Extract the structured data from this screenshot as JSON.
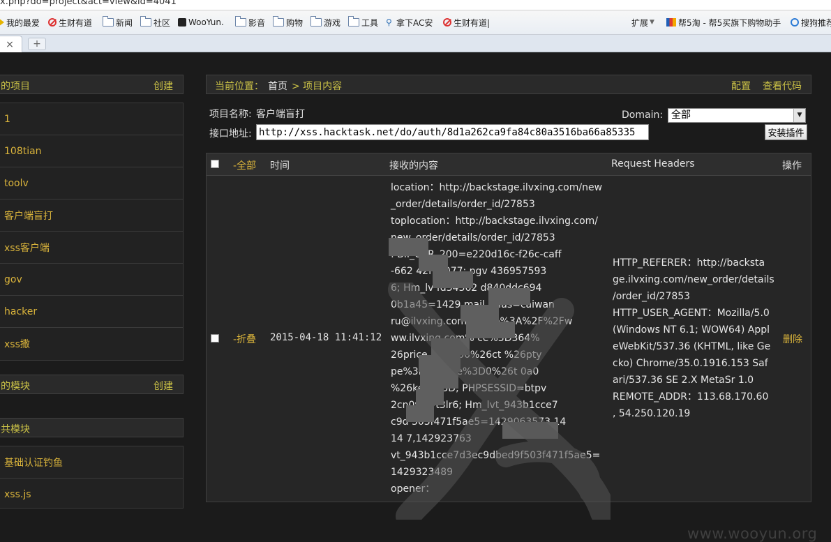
{
  "browser": {
    "url": "x.php?do=project&act=view&id=4041",
    "bookmarks": [
      {
        "label": "我的最爱",
        "icon": "favorites-icon"
      },
      {
        "label": "生财有道",
        "icon": "no-sign-icon"
      },
      {
        "label": "新闻",
        "icon": "folder-icon"
      },
      {
        "label": "社区",
        "icon": "folder-icon"
      },
      {
        "label": "WooYun.",
        "icon": "wooyun-icon"
      },
      {
        "label": "影音",
        "icon": "folder-icon"
      },
      {
        "label": "购物",
        "icon": "folder-icon"
      },
      {
        "label": "游戏",
        "icon": "folder-icon"
      },
      {
        "label": "工具",
        "icon": "folder-icon"
      },
      {
        "label": "拿下AC安",
        "icon": "ac-icon"
      },
      {
        "label": "生财有道|",
        "icon": "no-sign-icon"
      }
    ],
    "extensions_label": "扩展",
    "helper_label": "帮5淘 - 帮5买旗下购物助手",
    "search_label": "搜狗推荐",
    "tab_close": "×",
    "tab_new": "+"
  },
  "sidebar": {
    "projects_title": "的项目",
    "projects_create": "创建",
    "projects": [
      "1",
      "108tian",
      "toolv",
      "客户端盲打",
      "xss客户端",
      "gov",
      "hacker",
      "xss撒"
    ],
    "modules_title": "的模块",
    "modules_create": "创建",
    "public_title": "共模块",
    "public_items": [
      "基础认证钓鱼",
      "xss.js"
    ]
  },
  "main": {
    "breadcrumb_label": "当前位置：",
    "breadcrumb_home": "首页",
    "breadcrumb_current": "> 项目内容",
    "config_link": "配置",
    "code_link": "查看代码",
    "project_name_label": "项目名称:",
    "project_name": "客户端盲打",
    "api_label": "接口地址:",
    "api_url": "http://xss.hacktask.net/do/auth/8d1a262ca9fa84c80a3516ba66a85335",
    "domain_label": "Domain:",
    "domain_value": "全部",
    "install_button": "安装插件"
  },
  "table": {
    "col_all": "-全部",
    "col_time": "时间",
    "col_content": "接收的内容",
    "col_headers": "Request Headers",
    "col_action": "操作",
    "row": {
      "fold": "-折叠",
      "time": "2015-04-18 11:41:12",
      "delete": "删除",
      "content_lines": [
        "location：http://backstage.ilvxing.com/new",
        "_order/details/order_id/27853",
        "toplocation：http://backstage.ilvxing.com/",
        "new_order/details/order_id/27853",
        "      : BII_UER_200=e220d16c-f26c-caff",
        "-662     42f35077; pgv     436957593",
        "6; Hm_lv      fd34362       d840ddc694",
        "0b1a45=1429          mail_alias=caiwan",
        "ru@ilvxing.com; re      ttp%3A%2F%2Fw",
        "ww.ilvxing.com%          ce%3D364%",
        "26price_rang    00%26ct      %26pty",
        "pe%3D3%       ype%3D0%26t      0a0",
        "%26key        %3D; PHPSESSID=btpv     ",
        "2cn0v      7vt3lr6; Hm_lvt_943b1cce7",
        "c9d      503f471f5ae5=1429063573,14",
        "14      7,142923763",
        "vt_943b1cce7d3ec9dbed9f503f471f5ae5=",
        "1429323489",
        "opener："
      ],
      "header_lines": [
        "HTTP_REFERER：http://backsta",
        "ge.ilvxing.com/new_order/details",
        "/order_id/27853",
        "HTTP_USER_AGENT：Mozilla/5.0",
        "(Windows NT 6.1; WOW64) Appl",
        "eWebKit/537.36 (KHTML, like Ge",
        "cko) Chrome/35.0.1916.153 Saf",
        "ari/537.36 SE 2.X MetaSr 1.0",
        "REMOTE_ADDR：113.68.170.60",
        ", 54.250.120.19"
      ]
    }
  },
  "watermark": "www.wooyun.org",
  "colors": {
    "accent_yellow": "#c9c046",
    "link_orange": "#d9b33b",
    "background": "#1b1b1b"
  }
}
